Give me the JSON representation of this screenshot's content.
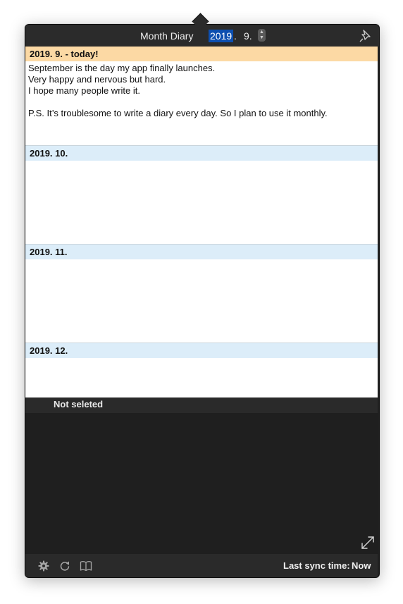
{
  "header": {
    "title": "Month Diary",
    "year": "2019",
    "year_separator": ".",
    "month": "9."
  },
  "entries": [
    {
      "label": "2019. 9. - today!",
      "text": "September is the day my app finally launches.\nVery happy and nervous but hard.\nI hope many people write it.\n\nP.S. It’s troublesome to write a diary every day. So I plan to use it monthly."
    },
    {
      "label": "2019. 10.",
      "text": ""
    },
    {
      "label": "2019. 11.",
      "text": ""
    },
    {
      "label": "2019. 12.",
      "text": ""
    }
  ],
  "status": {
    "selection": "Not seleted"
  },
  "footer": {
    "sync_label": "Last sync time:",
    "sync_value": "Now"
  },
  "icons": {
    "pin": "pin-icon",
    "expand": "expand-icon",
    "settings": "gear-icon",
    "refresh": "refresh-icon",
    "book": "book-icon"
  },
  "colors": {
    "today_header": "#fcd9a4",
    "month_header": "#dcedf9",
    "year_highlight": "#0d4fb0",
    "panel_dark": "#1f1f1f"
  }
}
